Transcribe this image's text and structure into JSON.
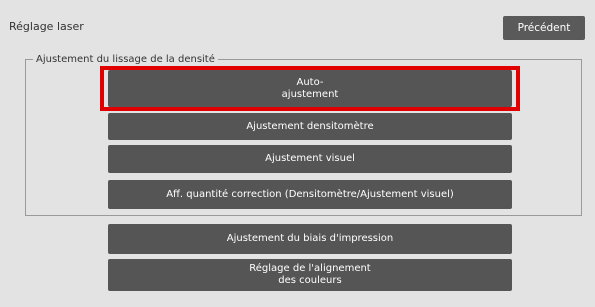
{
  "header": {
    "title": "Réglage laser",
    "back_label": "Précédent"
  },
  "group": {
    "label": "Ajustement du lissage de la densité",
    "buttons": [
      {
        "line1": "Auto-",
        "line2": "ajustement"
      },
      {
        "line1": "Ajustement densitomètre"
      },
      {
        "line1": "Ajustement visuel"
      },
      {
        "line1": "Aff. quantité correction (Densitomètre/Ajustement visuel)"
      }
    ]
  },
  "other_buttons": [
    {
      "line1": "Ajustement du biais d'impression"
    },
    {
      "line1": "Réglage de l'alignement",
      "line2": "des couleurs"
    }
  ],
  "highlight_color": "#e00000"
}
